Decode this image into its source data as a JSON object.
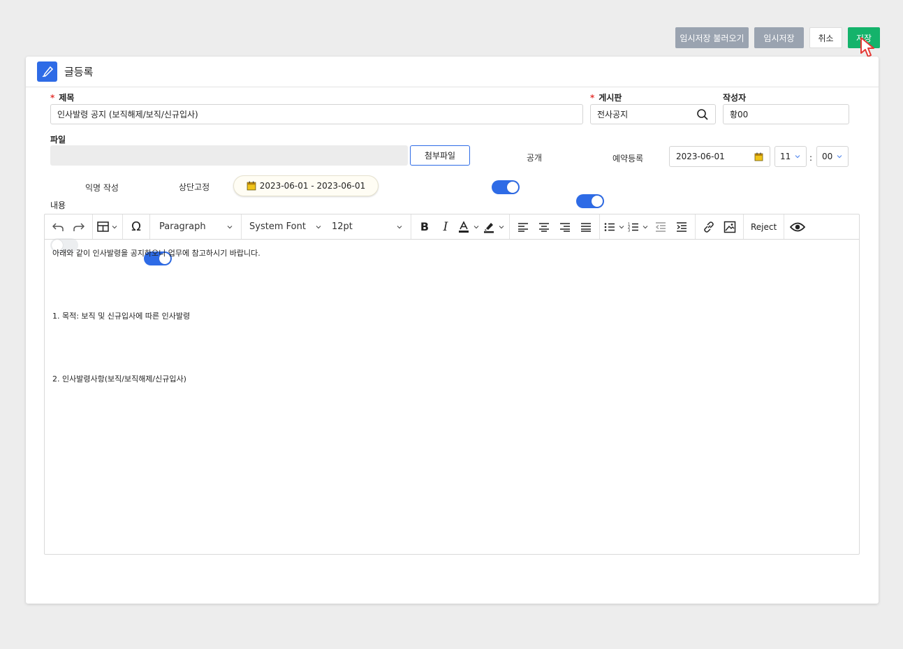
{
  "top_actions": {
    "load_draft_label": "임시저장 불러오기",
    "draft_label": "임시저장",
    "cancel_label": "취소",
    "save_label": "저장"
  },
  "panel": {
    "title": "글등록"
  },
  "form": {
    "title_label": "제목",
    "title_value": "인사발령 공지 (보직해제/보직/신규입사)",
    "board_label": "게시판",
    "board_value": "전사공지",
    "author_label": "작성자",
    "author_value": "황00",
    "file_label": "파일",
    "attach_label": "첨부파일",
    "public_label": "공개",
    "public_on": true,
    "reserve_label": "예약등록",
    "reserve_on": true,
    "reserve_date": "2023-06-01",
    "reserve_hour": "11",
    "time_sep": ":",
    "reserve_minute": "00",
    "anonymous_label": "익명 작성",
    "anonymous_on": false,
    "pin_label": "상단고정",
    "pin_on": true,
    "pin_range": "2023-06-01 - 2023-06-01",
    "content_label": "내용"
  },
  "toolbar": {
    "block_format": "Paragraph",
    "font_family": "System Font",
    "font_size": "12pt",
    "reject_label": "Reject"
  },
  "content": {
    "lines": [
      "아래와 같이 인사발령을 공지하오니 업무에 참고하시기 바랍니다.",
      "",
      "",
      "",
      "",
      "1. 목적: 보직 및 신규입사에 따른 인사발령",
      "",
      "",
      "",
      "",
      "2. 인사발령사항(보직/보직해제/신규입사)"
    ]
  },
  "colors": {
    "accent": "#2e6be6",
    "save": "#14b36b",
    "secondary": "#9aa3b0",
    "required": "#e53935"
  }
}
